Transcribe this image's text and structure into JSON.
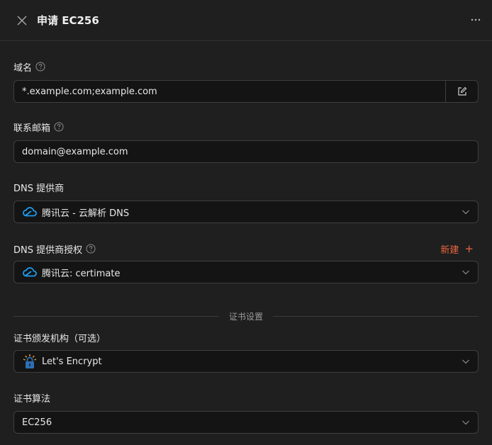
{
  "header": {
    "title": "申请 EC256",
    "more_label": "···"
  },
  "fields": {
    "domain": {
      "label": "域名",
      "value": "*.example.com;example.com"
    },
    "email": {
      "label": "联系邮箱",
      "value": "domain@example.com"
    },
    "dns_provider": {
      "label": "DNS 提供商",
      "value": "腾讯云 - 云解析 DNS"
    },
    "dns_auth": {
      "label": "DNS 提供商授权",
      "value": "腾讯云: certimate",
      "new_label": "新建",
      "new_plus": "+"
    },
    "section_divider": "证书设置",
    "ca": {
      "label": "证书颁发机构（可选）",
      "value": "Let's Encrypt"
    },
    "algorithm": {
      "label": "证书算法",
      "value": "EC256"
    }
  },
  "colors": {
    "accent": "#e8663d",
    "tencent_blue": "#1e9bf0",
    "letsencrypt_blue": "#2c6fb5"
  },
  "icons": {
    "close": "close-icon",
    "more": "more-icon",
    "help": "question-circle-icon",
    "edit": "edit-icon",
    "tencent": "tencent-cloud-icon",
    "letsencrypt": "letsencrypt-icon",
    "chevron": "chevron-down-icon"
  }
}
